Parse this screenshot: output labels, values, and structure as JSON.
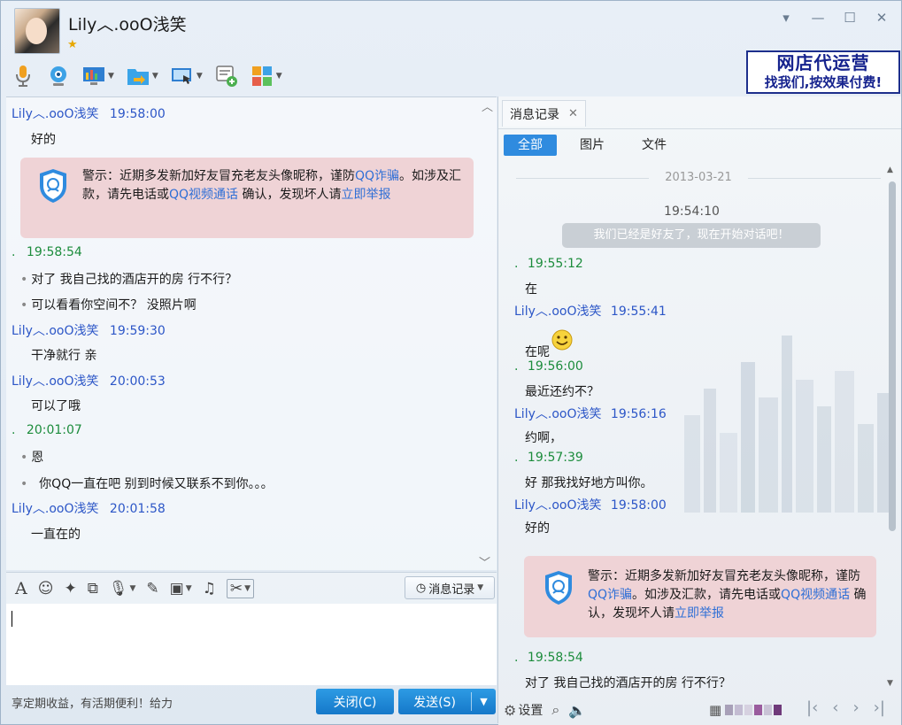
{
  "title": {
    "name": "Lily︿.ooO浅笑",
    "vip_star": "★"
  },
  "window_controls": {
    "menu": "▾",
    "minimize": "—",
    "maximize": "☐",
    "close": "✕"
  },
  "ad": {
    "line1": "网店代运营",
    "line2": "找我们,按效果付费!"
  },
  "toolbar": {
    "icons": [
      "microphone-icon",
      "webcam-icon",
      "screen-share-icon",
      "file-transfer-icon",
      "remote-assist-icon",
      "new-chat-icon",
      "apps-icon"
    ]
  },
  "chat_left": [
    {
      "type": "head",
      "who": "other",
      "name": "Lily︿.ooO浅笑",
      "time": "19:58:00"
    },
    {
      "type": "body",
      "text": "好的"
    },
    {
      "type": "head",
      "who": "me",
      "name": ".",
      "time": "19:58:54"
    },
    {
      "type": "body",
      "text": "对了  我自己找的酒店开的房 行不行？"
    },
    {
      "type": "body",
      "text": "可以看看你空间不？  没照片啊"
    },
    {
      "type": "head",
      "who": "other",
      "name": "Lily︿.ooO浅笑",
      "time": "19:59:30"
    },
    {
      "type": "body",
      "text": "干净就行 亲"
    },
    {
      "type": "head",
      "who": "other",
      "name": "Lily︿.ooO浅笑",
      "time": "20:00:53"
    },
    {
      "type": "body",
      "text": "可以了哦"
    },
    {
      "type": "head",
      "who": "me",
      "name": ".",
      "time": "20:01:07"
    },
    {
      "type": "body",
      "text": "恩"
    },
    {
      "type": "body",
      "text": "你QQ一直在吧  别到时候又联系不到你。。。"
    },
    {
      "type": "head",
      "who": "other",
      "name": "Lily︿.ooO浅笑",
      "time": "20:01:58"
    },
    {
      "type": "body",
      "text": "一直在的"
    }
  ],
  "warning_left": {
    "prefix": "警示：近期多发新加好友冒充老友头像昵称，谨防",
    "link1": "QQ诈骗",
    "mid1": "。如涉及汇款，请先电话或",
    "link2": "QQ视频通话",
    "mid2": " 确认，发现坏人请",
    "link3": "立即举报"
  },
  "input_toolbar": {
    "icons": [
      "font-icon",
      "emoji-icon",
      "magic-icon",
      "screenshot-icon",
      "voice-icon",
      "edit-icon",
      "image-icon",
      "music-icon",
      "scissors-icon"
    ],
    "history_label": "消息记录"
  },
  "promo_text": "享定期收益，有活期便利！给力",
  "buttons": {
    "close": "关闭(C)",
    "send": "发送(S)"
  },
  "history": {
    "tab_label": "消息记录",
    "filters": [
      "全部",
      "图片",
      "文件"
    ],
    "date": "2013-03-21",
    "sys_time": "19:54:10",
    "sys_message": "我们已经是好友了，现在开始对话吧！",
    "entries": [
      {
        "type": "head",
        "who": "me",
        "name": ".",
        "time": "19:55:12"
      },
      {
        "type": "body",
        "text": "在"
      },
      {
        "type": "head",
        "who": "other",
        "name": "Lily︿.ooO浅笑",
        "time": "19:55:41"
      },
      {
        "type": "body",
        "text": "在呢"
      },
      {
        "type": "head",
        "who": "me",
        "name": ".",
        "time": "19:56:00"
      },
      {
        "type": "body",
        "text": "最近还约不？"
      },
      {
        "type": "head",
        "who": "other",
        "name": "Lily︿.ooO浅笑",
        "time": "19:56:16"
      },
      {
        "type": "body",
        "text": "约啊，"
      },
      {
        "type": "head",
        "who": "me",
        "name": ".",
        "time": "19:57:39"
      },
      {
        "type": "body",
        "text": "好  那我找好地方叫你。"
      },
      {
        "type": "head",
        "who": "other",
        "name": "Lily︿.ooO浅笑",
        "time": "19:58:00"
      },
      {
        "type": "body",
        "text": "好的"
      },
      {
        "type": "head",
        "who": "me",
        "name": ".",
        "time": "19:58:54"
      },
      {
        "type": "body",
        "text": "对了  我自己找的酒店开的房 行不行？"
      }
    ],
    "warning": {
      "prefix": "警示：近期多发新加好友冒充老友头像昵称，谨防",
      "link1": "QQ诈骗",
      "mid1": "。如涉及汇款，请先电话或",
      "link2": "QQ视频通话",
      "mid2": " 确认，发现坏人请",
      "link3": "立即举报"
    },
    "bottom": {
      "settings": "设置"
    }
  },
  "colors": {
    "accent": "#2f8bdf",
    "name_blue": "#2c56c7",
    "self_green": "#1c8c3c",
    "warning_bg": "#efd3d6"
  }
}
